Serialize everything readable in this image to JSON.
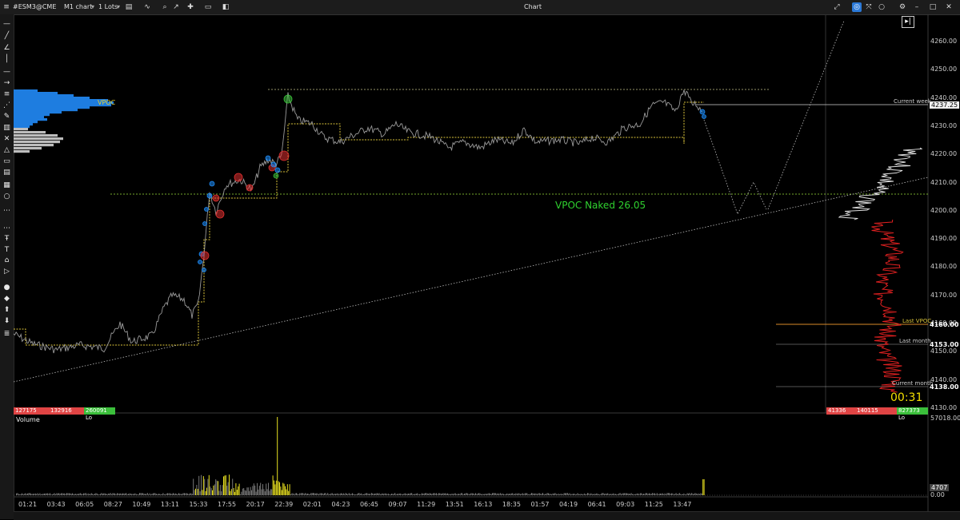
{
  "titlebar": {
    "symbol": "#ESM3@CME",
    "chart_period": "M1 chart",
    "lots": "1 Lots",
    "window_title": "Chart"
  },
  "price_axis": {
    "ticks": [
      "4260.00",
      "4250.00",
      "4240.00",
      "4230.00",
      "4220.00",
      "4210.00",
      "4200.00",
      "4190.00",
      "4180.00",
      "4170.00",
      "4160.00",
      "4150.00",
      "4140.00",
      "4130.00"
    ],
    "current_price": "4237.25",
    "labels": [
      {
        "text": "Current week",
        "price": "4237.25"
      },
      {
        "text": "Last VPOC",
        "price": "4160.00"
      },
      {
        "text": "Last month",
        "price": "4153.00"
      },
      {
        "text": "Current month",
        "price": "4138.00"
      }
    ]
  },
  "time_axis": [
    "01:21",
    "03:43",
    "06:05",
    "08:27",
    "10:49",
    "13:11",
    "15:33",
    "17:55",
    "20:17",
    "22:39",
    "02:01",
    "04:23",
    "06:45",
    "09:07",
    "11:29",
    "13:51",
    "16:13",
    "18:35",
    "01:57",
    "04:19",
    "06:41",
    "09:03",
    "11:25",
    "13:47"
  ],
  "annotations": {
    "vpoc_left": "VPOC",
    "vpoc_naked": "VPOC Naked 26.05",
    "timer": "00:31"
  },
  "bid_ask_left": {
    "red": "127175",
    "mid": "132916",
    "green": "260091 Lo"
  },
  "bid_ask_right": {
    "red": "41336",
    "mid": "140115",
    "green": "827373 Lo"
  },
  "volume_pane": {
    "title": "Volume",
    "max_label": "57018.00",
    "min_label": "0.00",
    "last_label": "4707"
  },
  "colors": {
    "background": "#000000",
    "price_line": "#9a9a9a",
    "vpoc_green": "#2fd12f",
    "level_yellow": "#d8c23a",
    "bid_red": "#e04040",
    "ask_green": "#3bbf3b",
    "profile_blue": "#1e7de0",
    "volume_yellow": "#e8e020"
  },
  "icons": [
    "menu-icon",
    "chart-type-icon",
    "indicator-icon",
    "zoom-icon",
    "crosshair-icon",
    "template-icon",
    "screenshot-icon",
    "settings-icon",
    "minimize-icon",
    "maximize-icon",
    "close-icon"
  ]
}
